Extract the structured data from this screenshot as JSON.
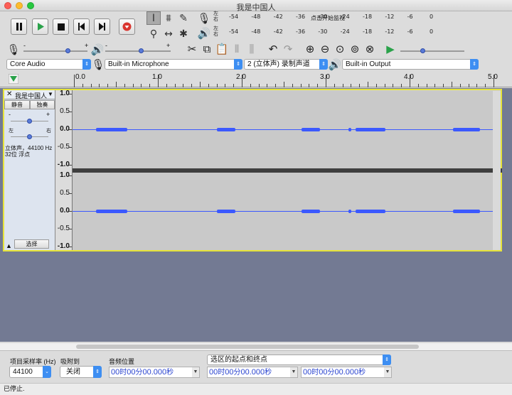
{
  "window": {
    "title": "我是中国人"
  },
  "transport": {
    "pause_icon": "pause-icon",
    "play_icon": "play-icon",
    "stop_icon": "stop-icon",
    "skip_start_icon": "skip-to-start-icon",
    "skip_end_icon": "skip-to-end-icon",
    "record_icon": "record-icon",
    "record_color": "#d9352f",
    "play_color": "#2aa24a"
  },
  "meters": {
    "record": {
      "left_label": "左",
      "right_label": "右",
      "ticks": [
        "-54",
        "-48",
        "-42",
        "-36",
        "-30",
        "-24",
        "-18",
        "-12",
        "-6",
        "0"
      ],
      "monitor_text": "点击开始监视"
    },
    "playback": {
      "left_label": "左",
      "right_label": "右",
      "ticks": [
        "-54",
        "-48",
        "-42",
        "-36",
        "-30",
        "-24",
        "-18",
        "-12",
        "-6",
        "0"
      ]
    }
  },
  "mixer": {
    "minus": "-",
    "plus": "+",
    "input_level": 0.7,
    "output_level": 0.55
  },
  "play_at_speed": {
    "level": 0.35
  },
  "devices": {
    "host": "Core Audio",
    "input_device": "Built-in Microphone",
    "channels": "2 (立体声) 录制声道",
    "output_device": "Built-in Output"
  },
  "ruler": {
    "labels": [
      "0.0",
      "1.0",
      "2.0",
      "3.0",
      "4.0",
      "5.0"
    ]
  },
  "track": {
    "name": "我是中国人",
    "mute_label": "静音",
    "solo_label": "独奏",
    "gain_minus": "-",
    "gain_plus": "+",
    "pan_left": "左",
    "pan_right": "右",
    "info_line1": "立体声，44100 Hz",
    "info_line2": "32位 浮点",
    "select_label": "选择",
    "vruler_ch1": [
      "1.0",
      "0.5",
      "0.0",
      "-0.5",
      "-1.0"
    ],
    "vruler_ch2": [
      "1.0",
      "0.5",
      "0.0",
      "-0.5",
      "-1.0"
    ]
  },
  "selection_bar": {
    "rate_label": "项目采样率 (Hz)",
    "rate_value": "44100",
    "snap_label": "吸附到",
    "snap_value": "关闭",
    "audio_pos_label": "音频位置",
    "selection_mode": "选区的起点和终点",
    "time_audio": {
      "h": "00",
      "h_unit": "时",
      "m": "00",
      "m_unit": "分",
      "s": "00.000",
      "s_unit": "秒"
    },
    "time_start": {
      "h": "00",
      "h_unit": "时",
      "m": "00",
      "m_unit": "分",
      "s": "00.000",
      "s_unit": "秒"
    },
    "time_end": {
      "h": "00",
      "h_unit": "时",
      "m": "00",
      "m_unit": "分",
      "s": "00.000",
      "s_unit": "秒"
    }
  },
  "status": {
    "text": "已停止."
  }
}
